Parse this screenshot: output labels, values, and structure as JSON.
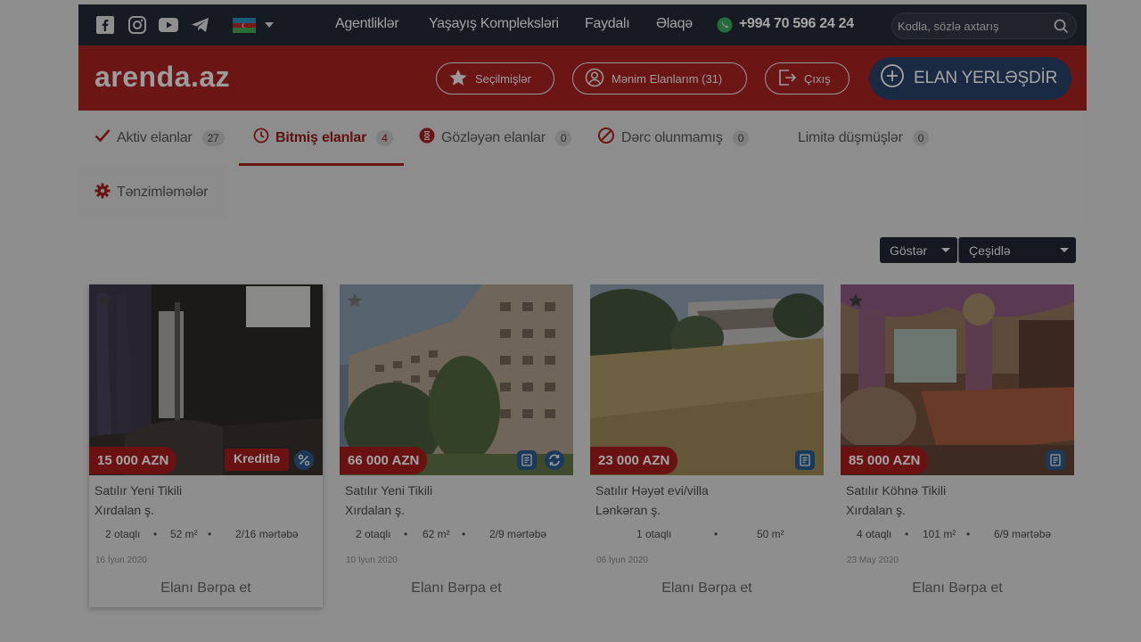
{
  "topbar": {
    "social_icons": [
      "facebook-icon",
      "instagram-icon",
      "youtube-icon",
      "telegram-icon"
    ],
    "language_flag": "azerbaijan-flag-icon",
    "nav": [
      "Agentliklər",
      "Yaşayış Kompleksləri",
      "Faydalı",
      "Əlaqə"
    ],
    "phone": "+994 70 596 24 24",
    "search_placeholder": "Kodla, sözlə axtarış"
  },
  "header": {
    "logo": "arenda.az",
    "favorites": "Seçilmişlər",
    "my_listings": "Mənim Elanlarım (31)",
    "logout": "Çıxış",
    "post_ad": "ELAN YERLƏŞDİR"
  },
  "tabs": [
    {
      "label": "Aktiv elanlar",
      "count": "27",
      "icon": "check-icon"
    },
    {
      "label": "Bitmiş elanlar",
      "count": "4",
      "icon": "clock-icon",
      "active": true
    },
    {
      "label": "Gözləyən elanlar",
      "count": "0",
      "icon": "pending-icon"
    },
    {
      "label": "Dərc olunmamış",
      "count": "0",
      "icon": "ban-icon"
    },
    {
      "label": "Limitə düşmüşlər",
      "count": "0"
    },
    {
      "label": "Tənzimləmələr",
      "icon": "gear-icon"
    }
  ],
  "controls": {
    "show": "Göstər",
    "sort": "Çeşidlə"
  },
  "listings": [
    {
      "price": "15 000 AZN",
      "badge": "Kreditlə",
      "title": "Satılır Yeni Tikili",
      "location": "Xırdalan ş.",
      "rooms": "2 otaqlı",
      "area": "52 m²",
      "floor": "2/16 mərtəbə",
      "date": "16 İyun 2020",
      "action": "Elanı Bərpa et"
    },
    {
      "price": "66 000 AZN",
      "title": "Satılır Yeni Tikili",
      "location": "Xırdalan ş.",
      "rooms": "2 otaqlı",
      "area": "62 m²",
      "floor": "2/9 mərtəbə",
      "date": "10 İyun 2020",
      "action": "Elanı Bərpa et"
    },
    {
      "price": "23 000 AZN",
      "title": "Satılır Həyət evi/villa",
      "location": "Lənkəran ş.",
      "rooms": "1 otaqlı",
      "area": "50 m²",
      "floor": "",
      "date": "06 İyun 2020",
      "action": "Elanı Bərpa et"
    },
    {
      "price": "85 000 AZN",
      "title": "Satılır Köhnə Tikili",
      "location": "Xırdalan ş.",
      "rooms": "4 otaqlı",
      "area": "101 m²",
      "floor": "6/9 mərtəbə",
      "date": "23 May 2020",
      "action": "Elanı Bərpa et"
    }
  ],
  "colors": {
    "brand_red": "#d32323",
    "dark_navy": "#232a38",
    "post_button_blue": "#2e5a9a"
  }
}
